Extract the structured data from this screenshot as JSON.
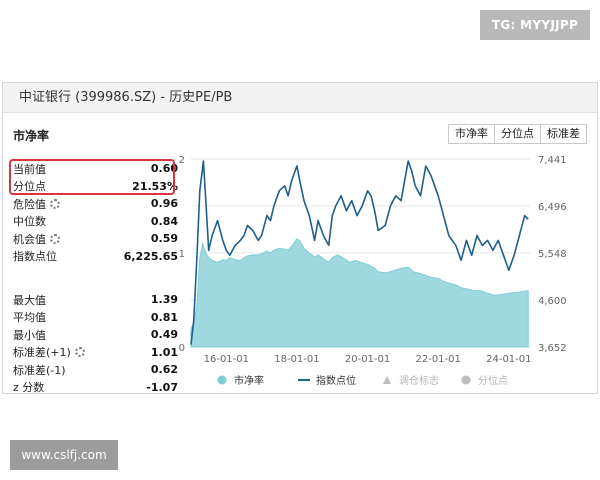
{
  "watermark_top": "TG: MYYJJPP",
  "watermark_bottom": "www.cslfj.com",
  "header": {
    "title": "中证银行 (399986.SZ) - 历史PE/PB"
  },
  "section": {
    "title": "市净率"
  },
  "buttons": [
    "市净率",
    "分位点",
    "标准差"
  ],
  "stats_top": [
    {
      "label": "当前值",
      "value": "0.60",
      "gear": false
    },
    {
      "label": "分位点",
      "value": "21.53%",
      "gear": false
    },
    {
      "label": "危险值",
      "value": "0.96",
      "gear": true
    },
    {
      "label": "中位数",
      "value": "0.84",
      "gear": false
    },
    {
      "label": "机会值",
      "value": "0.59",
      "gear": true
    },
    {
      "label": "指数点位",
      "value": "6,225.65",
      "gear": false
    }
  ],
  "stats_bottom": [
    {
      "label": "最大值",
      "value": "1.39",
      "gear": false
    },
    {
      "label": "平均值",
      "value": "0.81",
      "gear": false
    },
    {
      "label": "最小值",
      "value": "0.49",
      "gear": false
    },
    {
      "label": "标准差(+1)",
      "value": "1.01",
      "gear": true
    },
    {
      "label": "标准差(-1)",
      "value": "0.62",
      "gear": false
    },
    {
      "label": "z 分数",
      "value": "-1.07",
      "gear": false
    }
  ],
  "chart_data": {
    "type": "area",
    "x_ticks": [
      "16-01-01",
      "18-01-01",
      "20-01-01",
      "22-01-01",
      "24-01-01"
    ],
    "y_left_ticks": [
      "0",
      "1",
      "2"
    ],
    "y_left_range": [
      0,
      2
    ],
    "y_right_ticks": [
      "3,652",
      "4,600",
      "5,548",
      "6,496",
      "7,441"
    ],
    "y_right_range": [
      3652,
      7441
    ],
    "grid": true,
    "legend_position": "bottom",
    "colors": {
      "area": "#9fd9df",
      "area_line": "#7fcdd6",
      "index": "#1f5f8b",
      "legend_muted": "#bdbdbd"
    },
    "legend": [
      {
        "name": "市净率",
        "marker": "circle",
        "color": "#7fcdd6"
      },
      {
        "name": "指数点位",
        "marker": "line",
        "color": "#1f5f8b"
      },
      {
        "name": "调仓标志",
        "marker": "triangle",
        "color": "#bdbdbd"
      },
      {
        "name": "分位点",
        "marker": "circle",
        "color": "#bdbdbd"
      }
    ],
    "series": [
      {
        "name": "市净率",
        "axis": "left",
        "x": [
          2015.0,
          2015.08,
          2015.17,
          2015.25,
          2015.33,
          2015.42,
          2015.5,
          2015.6,
          2015.75,
          2015.9,
          2016.0,
          2016.1,
          2016.25,
          2016.4,
          2016.5,
          2016.6,
          2016.75,
          2016.9,
          2017.0,
          2017.15,
          2017.25,
          2017.35,
          2017.5,
          2017.65,
          2017.75,
          2017.85,
          2018.0,
          2018.08,
          2018.2,
          2018.35,
          2018.5,
          2018.6,
          2018.75,
          2018.9,
          2019.0,
          2019.15,
          2019.3,
          2019.5,
          2019.65,
          2019.8,
          2020.0,
          2020.1,
          2020.2,
          2020.3,
          2020.5,
          2020.65,
          2020.8,
          2021.0,
          2021.15,
          2021.3,
          2021.5,
          2021.65,
          2021.8,
          2022.0,
          2022.15,
          2022.3,
          2022.5,
          2022.65,
          2022.8,
          2023.0,
          2023.2,
          2023.4,
          2023.6,
          2023.8,
          2024.0,
          2024.2,
          2024.4,
          2024.55
        ],
        "y": [
          0.2,
          0.25,
          0.45,
          0.95,
          1.1,
          1.0,
          0.95,
          0.92,
          0.9,
          0.93,
          0.92,
          0.95,
          0.93,
          0.92,
          0.95,
          0.97,
          0.98,
          0.98,
          0.99,
          1.02,
          1.0,
          1.03,
          1.05,
          1.04,
          1.03,
          1.07,
          1.15,
          1.13,
          1.05,
          1.0,
          0.96,
          0.98,
          0.94,
          0.9,
          0.95,
          0.98,
          0.95,
          0.9,
          0.92,
          0.9,
          0.88,
          0.86,
          0.84,
          0.8,
          0.79,
          0.8,
          0.82,
          0.84,
          0.85,
          0.8,
          0.78,
          0.76,
          0.74,
          0.73,
          0.7,
          0.68,
          0.66,
          0.63,
          0.62,
          0.6,
          0.6,
          0.57,
          0.55,
          0.56,
          0.57,
          0.58,
          0.59,
          0.6
        ]
      },
      {
        "name": "指数点位",
        "axis": "right",
        "x": [
          2015.0,
          2015.08,
          2015.17,
          2015.25,
          2015.35,
          2015.42,
          2015.5,
          2015.6,
          2015.75,
          2015.9,
          2016.0,
          2016.1,
          2016.25,
          2016.4,
          2016.5,
          2016.6,
          2016.75,
          2016.9,
          2017.0,
          2017.15,
          2017.25,
          2017.35,
          2017.5,
          2017.65,
          2017.75,
          2017.85,
          2018.0,
          2018.08,
          2018.2,
          2018.35,
          2018.5,
          2018.6,
          2018.75,
          2018.9,
          2019.0,
          2019.1,
          2019.25,
          2019.4,
          2019.55,
          2019.7,
          2019.85,
          2020.0,
          2020.1,
          2020.2,
          2020.3,
          2020.5,
          2020.65,
          2020.8,
          2020.95,
          2021.05,
          2021.15,
          2021.25,
          2021.35,
          2021.5,
          2021.65,
          2021.8,
          2022.0,
          2022.15,
          2022.3,
          2022.5,
          2022.65,
          2022.8,
          2022.95,
          2023.1,
          2023.25,
          2023.4,
          2023.55,
          2023.7,
          2023.85,
          2024.0,
          2024.15,
          2024.3,
          2024.45,
          2024.55
        ],
        "y": [
          3700,
          4200,
          5500,
          6800,
          7400,
          6600,
          5600,
          5900,
          6200,
          5800,
          5600,
          5500,
          5700,
          5800,
          5900,
          6100,
          6000,
          5800,
          5900,
          6300,
          6200,
          6500,
          6800,
          6900,
          6700,
          7000,
          7300,
          7000,
          6600,
          6300,
          5800,
          6200,
          5900,
          5700,
          6300,
          6500,
          6700,
          6400,
          6600,
          6300,
          6500,
          6800,
          6700,
          6400,
          6000,
          6100,
          6500,
          6700,
          6600,
          7000,
          7400,
          7200,
          6900,
          6700,
          7300,
          7100,
          6700,
          6300,
          5900,
          5700,
          5400,
          5800,
          5500,
          5900,
          5700,
          5800,
          5600,
          5800,
          5500,
          5200,
          5500,
          5900,
          6300,
          6225.65
        ]
      }
    ]
  }
}
